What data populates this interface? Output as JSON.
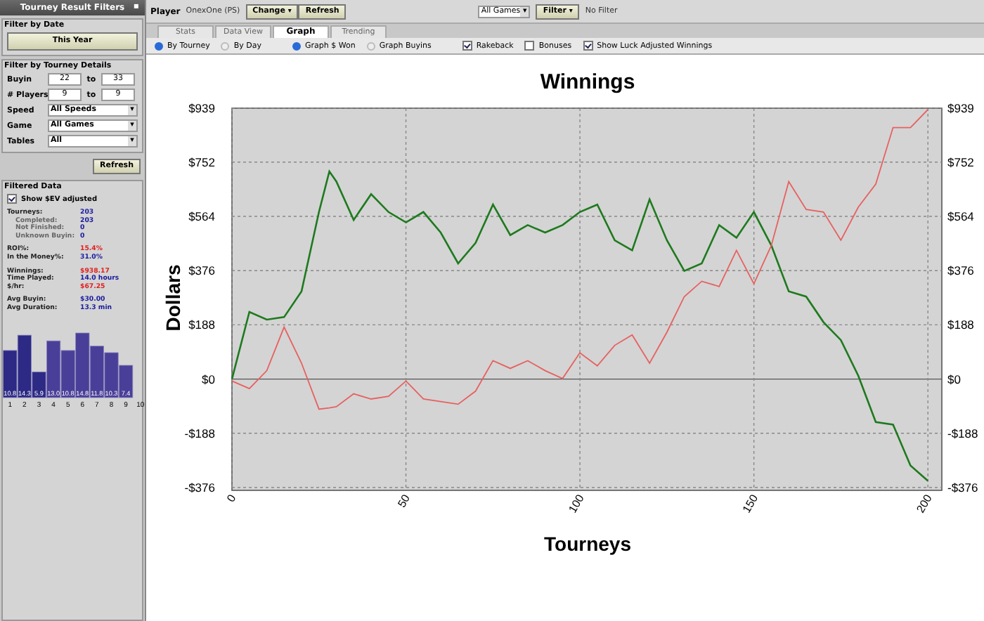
{
  "sidebar": {
    "title": "Tourney Result Filters",
    "pin": "▪",
    "date_section": {
      "title": "Filter by Date",
      "button": "This Year"
    },
    "details_section": {
      "title": "Filter by Tourney Details",
      "ranges": [
        {
          "label": "Buyin",
          "from": "22",
          "joiner": "to",
          "to": "33"
        },
        {
          "label": "# Players",
          "from": "9",
          "joiner": "to",
          "to": "9"
        }
      ],
      "dropdown_arrow": "▾",
      "selects": [
        {
          "label": "Speed",
          "value": "All Speeds"
        },
        {
          "label": "Game",
          "value": "All Games"
        },
        {
          "label": "Tables",
          "value": "All"
        }
      ],
      "button": "Refresh"
    },
    "filtered": {
      "title": "Filtered Data",
      "checkbox": {
        "label": "Show $EV adjusted",
        "checked": true
      },
      "groups": [
        [
          {
            "label": "Tourneys:",
            "value": "203",
            "color": "#1a1aa0",
            "children": [
              {
                "label": "Completed:",
                "value": "203",
                "color": "#1a1aa0"
              },
              {
                "label": "Not Finished:",
                "value": "0",
                "color": "#1a1aa0"
              },
              {
                "label": "Unknown Buyin:",
                "value": "0",
                "color": "#1a1aa0"
              }
            ]
          }
        ],
        [
          {
            "label": "ROI%:",
            "value": "15.4%",
            "color": "#e02020"
          },
          {
            "label": "In the Money%:",
            "value": "31.0%",
            "color": "#1a1aa0"
          }
        ],
        [
          {
            "label": "Winnings:",
            "value": "$938.17",
            "color": "#e02020"
          },
          {
            "label": "Time Played:",
            "value": "14.0 hours",
            "color": "#1a1aa0"
          },
          {
            "label": "$/hr:",
            "value": "$67.25",
            "color": "#e02020"
          }
        ],
        [
          {
            "label": "Avg Buyin:",
            "value": "$30.00",
            "color": "#1a1aa0"
          },
          {
            "label": "Avg Duration:",
            "value": "13.3 min",
            "color": "#1a1aa0"
          }
        ]
      ],
      "chart_data": {
        "type": "bar",
        "categories": [
          "1",
          "2",
          "3",
          "4",
          "5",
          "6",
          "7",
          "8",
          "9",
          "10"
        ],
        "values": [
          10.8,
          14.3,
          5.9,
          13.0,
          10.8,
          14.8,
          11.8,
          10.3,
          7.4,
          null
        ],
        "value_labels": [
          "10.8",
          "14.3",
          "5.9",
          "13.0",
          "10.8",
          "14.8",
          "11.8",
          "10.3",
          "7.4",
          null
        ]
      }
    }
  },
  "toolbar": {
    "arrow": "▾",
    "player_label": "Player",
    "player": "OnexOne (PS)",
    "change": "Change",
    "refresh": "Refresh",
    "games": "All Games",
    "filter": "Filter",
    "filter_status": "No Filter"
  },
  "tabs": [
    {
      "label": "Stats",
      "selected": false
    },
    {
      "label": "Data View",
      "selected": false
    },
    {
      "label": "Graph",
      "selected": true
    },
    {
      "label": "Trending",
      "selected": false
    }
  ],
  "options": [
    {
      "kind": "radio",
      "label": "By Tourney",
      "selected": true
    },
    {
      "kind": "radio",
      "label": "By Day",
      "selected": false
    },
    {
      "kind": "radio",
      "label": "Graph $ Won",
      "selected": true
    },
    {
      "kind": "radio",
      "label": "Graph Buyins",
      "selected": false
    },
    {
      "kind": "checkbox",
      "label": "Rakeback",
      "checked": true
    },
    {
      "kind": "checkbox",
      "label": "Bonuses",
      "checked": false
    },
    {
      "kind": "checkbox",
      "label": "Show Luck Adjusted Winnings",
      "checked": true
    }
  ],
  "chart_data": {
    "type": "line",
    "title": "Winnings",
    "xlabel": "Tourneys",
    "ylabel": "Dollars",
    "x": [
      0,
      5,
      10,
      15,
      20,
      25,
      28,
      30,
      35,
      40,
      45,
      50,
      55,
      60,
      65,
      70,
      75,
      80,
      85,
      90,
      95,
      100,
      105,
      110,
      115,
      120,
      125,
      130,
      135,
      140,
      145,
      150,
      155,
      160,
      165,
      170,
      175,
      180,
      185,
      190,
      195,
      200
    ],
    "series": [
      {
        "color": "#1e7a1e",
        "values": [
          0,
          233,
          206,
          215,
          304,
          579,
          720,
          685,
          552,
          641,
          579,
          543,
          579,
          508,
          401,
          472,
          605,
          499,
          534,
          508,
          534,
          579,
          605,
          481,
          446,
          623,
          481,
          375,
          401,
          534,
          490,
          579,
          463,
          304,
          286,
          197,
          135,
          11,
          -149,
          -158,
          -300,
          -353
        ]
      },
      {
        "color": "#e86060",
        "values": [
          -7,
          -33,
          29,
          180,
          55,
          -104,
          -100,
          -96,
          -51,
          -69,
          -60,
          -7,
          -69,
          -78,
          -87,
          -42,
          64,
          37,
          64,
          29,
          2,
          91,
          46,
          117,
          153,
          55,
          162,
          286,
          339,
          321,
          446,
          330,
          463,
          685,
          588,
          579,
          481,
          596,
          676,
          872,
          872,
          934
        ]
      }
    ],
    "grid": true,
    "xlim": [
      0,
      204
    ],
    "ylim": [
      -376,
      939
    ],
    "xticks": [
      0,
      50,
      100,
      150,
      200
    ],
    "yticks": [
      {
        "value": 939,
        "label": "$939"
      },
      {
        "value": 752,
        "label": "$752"
      },
      {
        "value": 564,
        "label": "$564"
      },
      {
        "value": 376,
        "label": "$376"
      },
      {
        "value": 188,
        "label": "$188"
      },
      {
        "value": 0,
        "label": "$0"
      },
      {
        "value": -188,
        "label": "-$188"
      },
      {
        "value": -376,
        "label": "-$376"
      }
    ]
  }
}
